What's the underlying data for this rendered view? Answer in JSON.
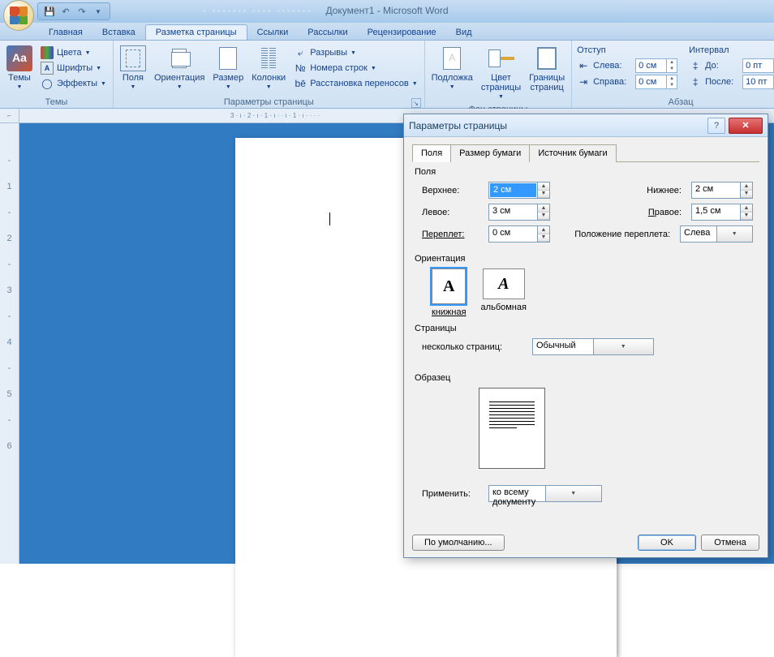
{
  "title": "Документ1 - Microsoft Word",
  "tabs": {
    "home": "Главная",
    "insert": "Вставка",
    "pagelayout": "Разметка страницы",
    "refs": "Ссылки",
    "mailings": "Рассылки",
    "review": "Рецензирование",
    "view": "Вид"
  },
  "ribbon": {
    "themes": {
      "label": "Темы",
      "themes_btn": "Темы",
      "colors": "Цвета",
      "fonts": "Шрифты",
      "effects": "Эффекты"
    },
    "page_setup": {
      "label": "Параметры страницы",
      "margins": "Поля",
      "orientation": "Ориентация",
      "size": "Размер",
      "columns": "Колонки",
      "breaks": "Разрывы",
      "linenumbers": "Номера строк",
      "hyphen": "Расстановка переносов"
    },
    "page_bg": {
      "label": "Фон страницы",
      "watermark": "Подложка",
      "pagecolor": "Цвет\nстраницы",
      "borders": "Границы\nстраниц"
    },
    "indent": {
      "header": "Отступ",
      "left": "Слева:",
      "left_val": "0 см",
      "right": "Справа:",
      "right_val": "0 см"
    },
    "spacing": {
      "header": "Интервал",
      "before": "До:",
      "before_val": "0 пт",
      "after": "После:",
      "after_val": "10 пт"
    },
    "para_label": "Абзац"
  },
  "dialog": {
    "title": "Параметры страницы",
    "tabs": {
      "margins": "Поля",
      "paper": "Размер бумаги",
      "layout": "Источник бумаги"
    },
    "fs_margins": "Поля",
    "top": "Верхнее:",
    "top_val": "2 см",
    "bottom": "Нижнее:",
    "bottom_val": "2 см",
    "left": "Левое:",
    "left_val": "3 см",
    "right": "Правое:",
    "right_val": "1,5 см",
    "gutter": "Переплет:",
    "gutter_val": "0 см",
    "gutter_pos": "Положение переплета:",
    "gutter_pos_val": "Слева",
    "fs_orient": "Ориентация",
    "portrait": "книжная",
    "landscape": "альбомная",
    "fs_pages": "Страницы",
    "multi_pages": "несколько страниц:",
    "multi_pages_val": "Обычный",
    "fs_preview": "Образец",
    "apply_to": "Применить:",
    "apply_to_val": "ко всему документу",
    "default_btn": "По умолчанию...",
    "ok": "OK",
    "cancel": "Отмена"
  },
  "hruler_text": "3 · ı · 2 · ı · 1 · ı ·  · ı · 1 · ı · · · ·"
}
